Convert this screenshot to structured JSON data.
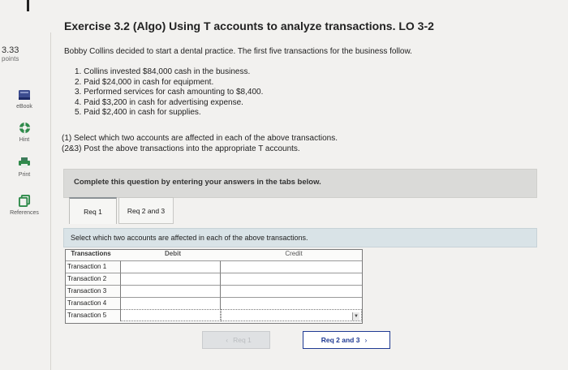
{
  "exercise": {
    "title": "Exercise 3.2 (Algo) Using T accounts to analyze transactions. LO 3-2"
  },
  "score": {
    "value": "3.33",
    "unit": "points"
  },
  "sidebar": {
    "items": [
      {
        "label": "eBook",
        "icon": "book-icon"
      },
      {
        "label": "Hint",
        "icon": "lifebuoy-icon"
      },
      {
        "label": "Print",
        "icon": "printer-icon"
      },
      {
        "label": "References",
        "icon": "references-icon"
      }
    ]
  },
  "problem": {
    "intro": "Bobby Collins decided to start a dental practice. The first five transactions for the business follow.",
    "transactions": [
      "1. Collins invested $84,000 cash in the business.",
      "2. Paid $24,000 in cash for equipment.",
      "3. Performed services for cash amounting to $8,400.",
      "4. Paid $3,200 in cash for advertising expense.",
      "5. Paid $2,400 in cash for supplies."
    ],
    "instructions": [
      "(1) Select which two accounts are affected in each of the above transactions.",
      "(2&3) Post the above transactions into the appropriate T accounts."
    ]
  },
  "banner": {
    "text": "Complete this question by entering your answers in the tabs below."
  },
  "tabs": [
    {
      "label": "Req 1",
      "active": true
    },
    {
      "label": "Req 2 and 3",
      "active": false
    }
  ],
  "question": {
    "prompt": "Select which two accounts are affected in each of the above transactions."
  },
  "table": {
    "headers": {
      "transactions": "Transactions",
      "debit": "Debit",
      "credit": "Credit"
    },
    "rows": [
      {
        "label": "Transaction 1",
        "debit": "",
        "credit": ""
      },
      {
        "label": "Transaction 2",
        "debit": "",
        "credit": ""
      },
      {
        "label": "Transaction 3",
        "debit": "",
        "credit": ""
      },
      {
        "label": "Transaction 4",
        "debit": "",
        "credit": ""
      },
      {
        "label": "Transaction 5",
        "debit": "",
        "credit": ""
      }
    ]
  },
  "nav": {
    "prev_label": "Req 1",
    "next_label": "Req 2 and 3"
  },
  "colors": {
    "accent": "#1f3a93",
    "question_bar": "#d9e3e7",
    "banner": "#dadad8"
  }
}
